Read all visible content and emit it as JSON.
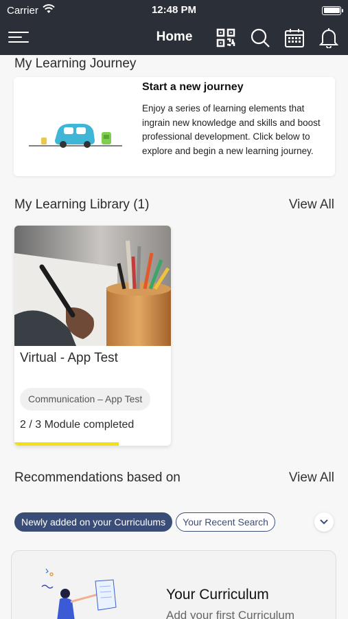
{
  "status_bar": {
    "carrier": "Carrier",
    "time": "12:48 PM"
  },
  "header": {
    "title": "Home",
    "icons": [
      "menu-icon",
      "qr-code-icon",
      "search-icon",
      "calendar-icon",
      "bell-icon"
    ]
  },
  "journey": {
    "section_title": "My Learning Journey",
    "card_title": "Start a new journey",
    "card_description": "Enjoy a series of learning elements that ingrain new knowledge and skills and boost professional development. Click below to explore and begin a new learning journey."
  },
  "library": {
    "section_title": "My Learning Library (1)",
    "view_all": "View All",
    "courses": [
      {
        "title": "Virtual - App Test",
        "tag": "Communication – App Test",
        "progress_text": "2 / 3 Module completed",
        "progress_fraction": 0.667
      }
    ]
  },
  "recommendations": {
    "section_title": "Recommendations based on",
    "view_all": "View All",
    "chips": [
      {
        "label": "Newly added on your Curriculums",
        "active": true
      },
      {
        "label": "Your Recent Search",
        "active": false
      }
    ],
    "card_title": "Your Curriculum",
    "card_subtitle": "Add your first Curriculum"
  },
  "colors": {
    "header_bg": "#2b2f37",
    "chip_active": "#3a4d77",
    "progress": "#f2e11a",
    "car": "#3fb6d6"
  }
}
